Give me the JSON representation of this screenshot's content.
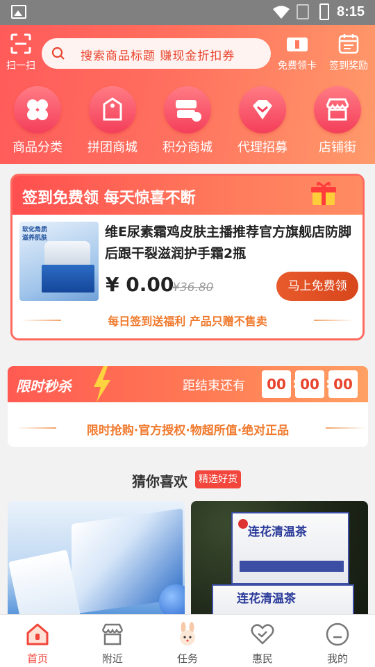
{
  "status_bar": {
    "time": "8:15"
  },
  "header": {
    "scan_label": "扫一扫",
    "search_placeholder": "搜索商品标题 赚现金折扣券",
    "free_card_label": "免费领卡",
    "sign_reward_label": "签到奖励"
  },
  "categories": [
    {
      "label": "商品分类",
      "icon": "clover-icon"
    },
    {
      "label": "拼团商城",
      "icon": "price-tag-icon"
    },
    {
      "label": "积分商城",
      "icon": "coupon-stack-icon"
    },
    {
      "label": "代理招募",
      "icon": "diamond-icon"
    },
    {
      "label": "店铺街",
      "icon": "storefront-icon"
    }
  ],
  "signin_card": {
    "title": "签到免费领 每天惊喜不断",
    "product_name": "维E尿素霜鸡皮肤主播推荐官方旗舰店防脚后跟干裂滋润护手霜2瓶",
    "product_img_tag": "软化角质 滋养肌肤",
    "price": "¥ 0.00",
    "original_price": "¥36.80",
    "button_label": "马上免费领",
    "footer": "每日签到送福利 产品只赠不售卖"
  },
  "flash_sale": {
    "title": "限时秒杀",
    "ends_label": "距结束还有",
    "countdown": [
      "00",
      "00",
      "00"
    ],
    "slogan": "限时抢购·官方授权·物超所值·绝对正品"
  },
  "recommend": {
    "title": "猜你喜欢",
    "badge": "精选好货",
    "card2_brand_line1": "连花清温茶",
    "card2_brand_line2": "连花清温茶"
  },
  "bottom_nav": [
    {
      "label": "首页",
      "icon": "home-icon",
      "active": true
    },
    {
      "label": "附近",
      "icon": "shop-icon",
      "active": false
    },
    {
      "label": "任务",
      "icon": "rabbit-icon",
      "active": false
    },
    {
      "label": "惠民",
      "icon": "heart-icon",
      "active": false
    },
    {
      "label": "我的",
      "icon": "profile-icon",
      "active": false
    }
  ],
  "colors": {
    "accent": "#f2453b",
    "header_start": "#ff5a5a",
    "header_end": "#ff9a6a",
    "highlight_orange": "#f07a2e"
  }
}
